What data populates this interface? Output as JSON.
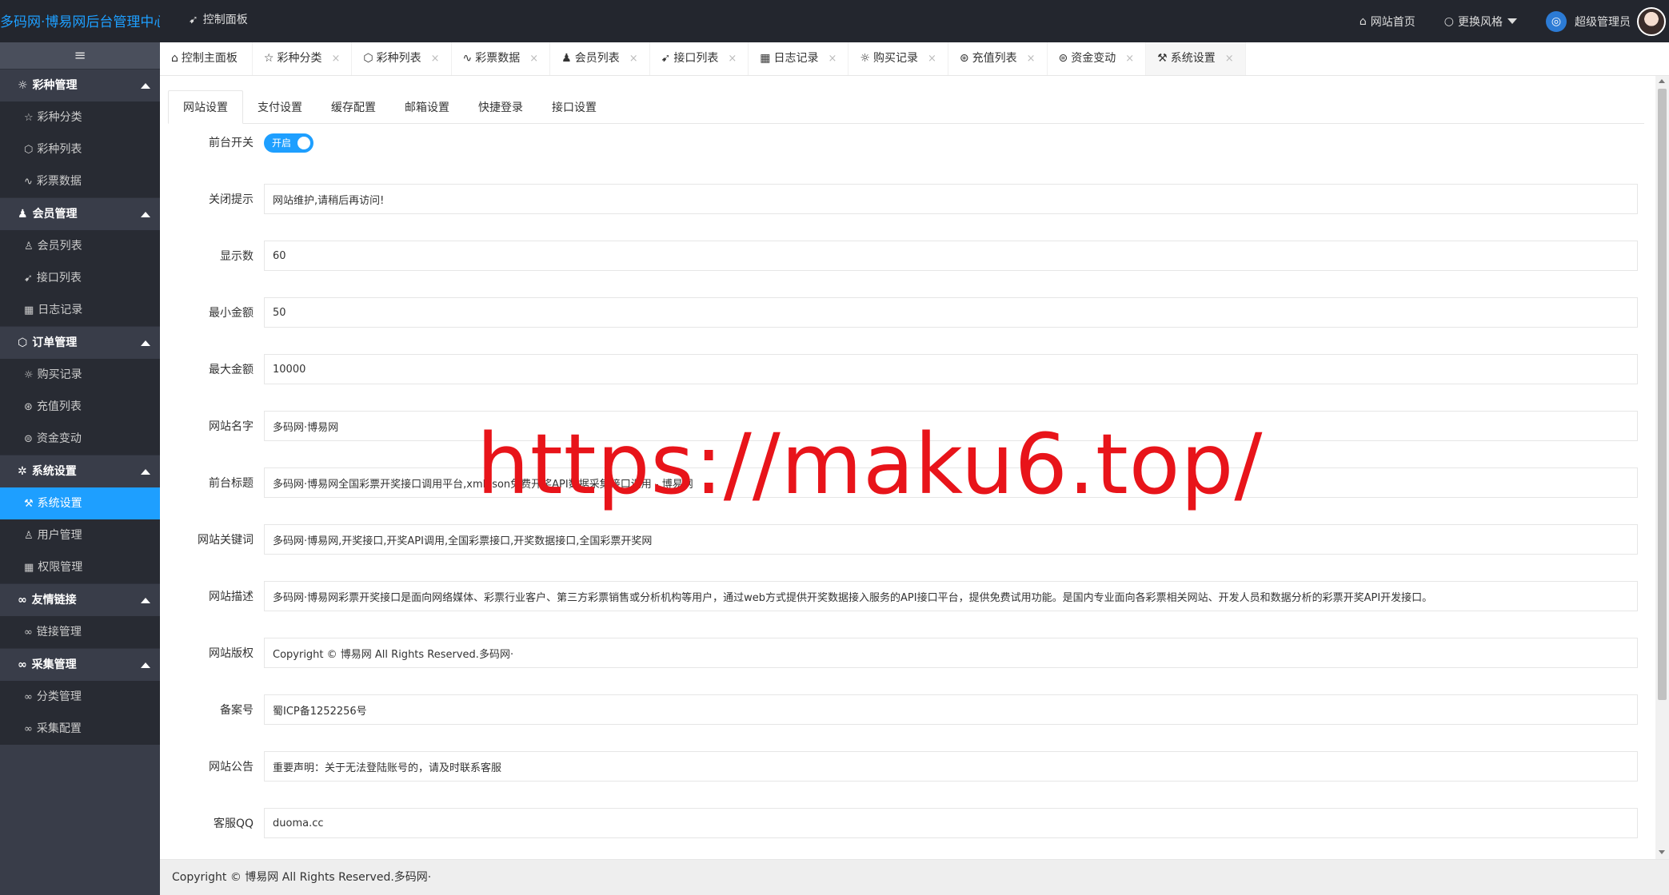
{
  "app": {
    "logo_text": "多码网·博易网后台管理中心",
    "top_nav_label": "控制面板",
    "top_right": {
      "home_label": "网站首页",
      "theme_label": "更换风格",
      "user_label": "超级管理员"
    }
  },
  "sidebar": {
    "toggle_icon": "≡",
    "groups": [
      {
        "label": "彩种管理",
        "items": [
          "彩种分类",
          "彩种列表",
          "彩票数据"
        ]
      },
      {
        "label": "会员管理",
        "items": [
          "会员列表",
          "接口列表",
          "日志记录"
        ]
      },
      {
        "label": "订单管理",
        "items": [
          "购买记录",
          "充值列表",
          "资金变动"
        ]
      },
      {
        "label": "系统设置",
        "items": [
          "系统设置",
          "用户管理",
          "权限管理"
        ],
        "active_item": "系统设置"
      },
      {
        "label": "友情链接",
        "items": [
          "链接管理"
        ]
      },
      {
        "label": "采集管理",
        "items": [
          "分类管理",
          "采集配置"
        ]
      }
    ]
  },
  "tabs": [
    {
      "label": "控制主面板",
      "closable": false
    },
    {
      "label": "彩种分类",
      "closable": true
    },
    {
      "label": "彩种列表",
      "closable": true
    },
    {
      "label": "彩票数据",
      "closable": true
    },
    {
      "label": "会员列表",
      "closable": true
    },
    {
      "label": "接口列表",
      "closable": true
    },
    {
      "label": "日志记录",
      "closable": true
    },
    {
      "label": "购买记录",
      "closable": true
    },
    {
      "label": "充值列表",
      "closable": true
    },
    {
      "label": "资金变动",
      "closable": true
    },
    {
      "label": "系统设置",
      "closable": true,
      "active": true
    }
  ],
  "subtabs": [
    "网站设置",
    "支付设置",
    "缓存配置",
    "邮箱设置",
    "快捷登录",
    "接口设置"
  ],
  "form": {
    "frontend_switch": {
      "label": "前台开关",
      "value": "开启"
    },
    "fields": [
      {
        "label": "关闭提示",
        "value": "网站维护,请稍后再访问!"
      },
      {
        "label": "显示数",
        "value": "60"
      },
      {
        "label": "最小金额",
        "value": "50"
      },
      {
        "label": "最大金额",
        "value": "10000"
      },
      {
        "label": "网站名字",
        "value": "多码网·博易网"
      },
      {
        "label": "前台标题",
        "value": "多码网·博易网全国彩票开奖接口调用平台,xml,Json免费开奖API数据采集接口调用 - 博易网"
      },
      {
        "label": "网站关键词",
        "value": "多码网·博易网,开奖接口,开奖API调用,全国彩票接口,开奖数据接口,全国彩票开奖网"
      },
      {
        "label": "网站描述",
        "value": "多码网·博易网彩票开奖接口是面向网络媒体、彩票行业客户、第三方彩票销售或分析机构等用户，通过web方式提供开奖数据接入服务的API接口平台，提供免费试用功能。是国内专业面向各彩票相关网站、开发人员和数据分析的彩票开奖API开发接口。"
      },
      {
        "label": "网站版权",
        "value": "Copyright © 博易网 All Rights Reserved.多码网·"
      },
      {
        "label": "备案号",
        "value": "蜀ICP备1252256号"
      },
      {
        "label": "网站公告",
        "value": "重要声明：关于无法登陆账号的，请及时联系客服"
      },
      {
        "label": "客服QQ",
        "value": "duoma.cc"
      }
    ]
  },
  "footer": {
    "text": "Copyright © 博易网 All Rights Reserved.多码网·"
  },
  "watermark": {
    "text": "https://maku6.top/"
  }
}
